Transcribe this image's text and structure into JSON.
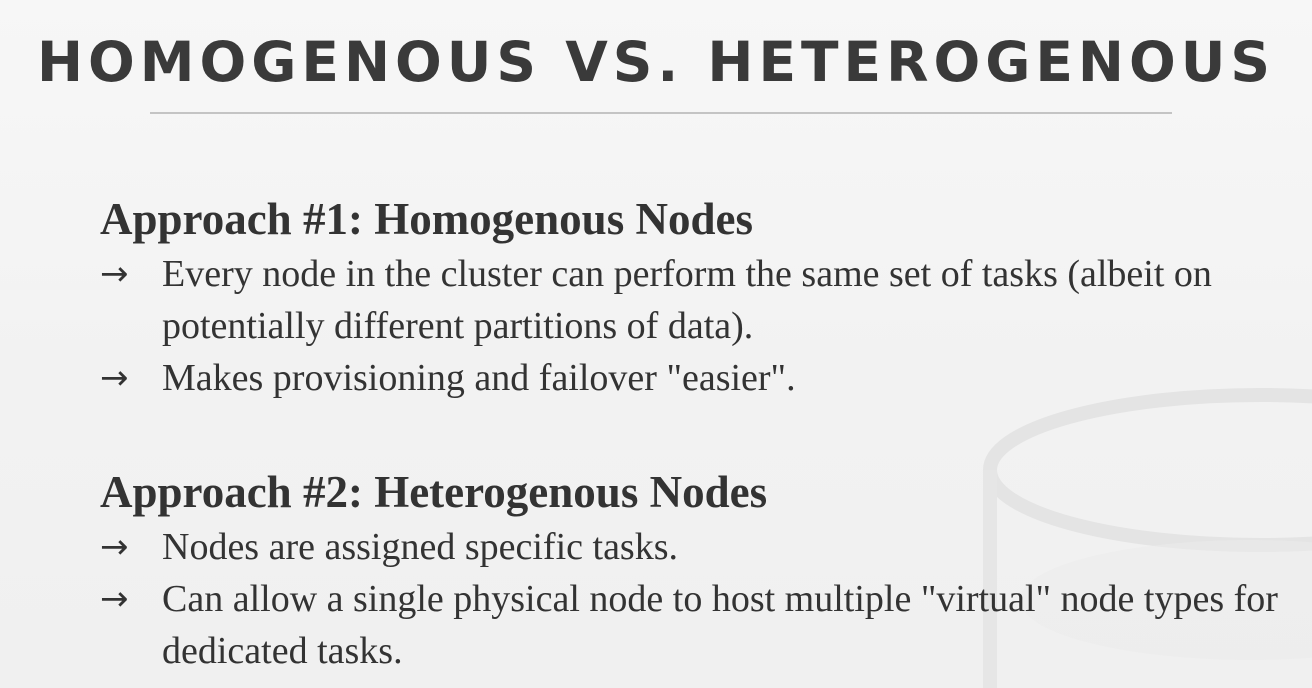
{
  "slide": {
    "title": "HOMOGENOUS VS. HETEROGENOUS",
    "bullet_glyph": "→",
    "sections": [
      {
        "heading": "Approach #1: Homogenous Nodes",
        "bullets": [
          "Every node in the cluster can perform the same set of tasks (albeit on potentially different partitions of data).",
          "Makes provisioning and failover \"easier\"."
        ]
      },
      {
        "heading": "Approach #2: Heterogenous Nodes",
        "bullets": [
          "Nodes are assigned specific tasks.",
          "Can allow a single physical node to host multiple \"virtual\" node types for dedicated tasks."
        ]
      }
    ]
  },
  "colors": {
    "background": "#f4f4f4",
    "text": "#333333",
    "title": "#3a3a3a",
    "rule": "#c4c4c4"
  }
}
